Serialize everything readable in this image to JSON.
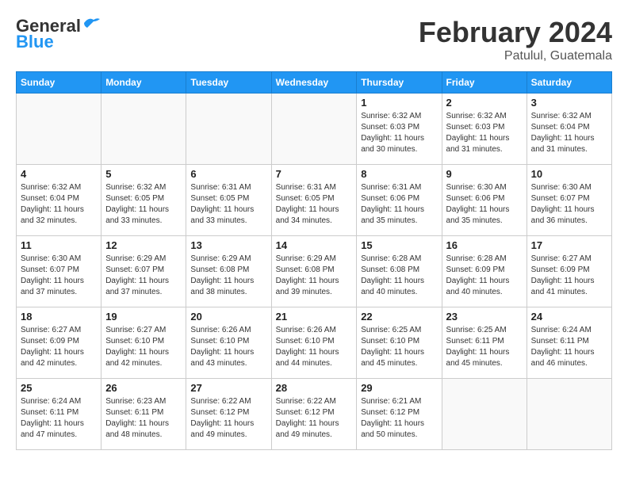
{
  "header": {
    "logo_general": "General",
    "logo_blue": "Blue",
    "month": "February 2024",
    "location": "Patulul, Guatemala"
  },
  "days_of_week": [
    "Sunday",
    "Monday",
    "Tuesday",
    "Wednesday",
    "Thursday",
    "Friday",
    "Saturday"
  ],
  "weeks": [
    [
      {
        "day": "",
        "empty": true
      },
      {
        "day": "",
        "empty": true
      },
      {
        "day": "",
        "empty": true
      },
      {
        "day": "",
        "empty": true
      },
      {
        "day": "1",
        "sunrise": "Sunrise: 6:32 AM",
        "sunset": "Sunset: 6:03 PM",
        "daylight": "Daylight: 11 hours and 30 minutes."
      },
      {
        "day": "2",
        "sunrise": "Sunrise: 6:32 AM",
        "sunset": "Sunset: 6:03 PM",
        "daylight": "Daylight: 11 hours and 31 minutes."
      },
      {
        "day": "3",
        "sunrise": "Sunrise: 6:32 AM",
        "sunset": "Sunset: 6:04 PM",
        "daylight": "Daylight: 11 hours and 31 minutes."
      }
    ],
    [
      {
        "day": "4",
        "sunrise": "Sunrise: 6:32 AM",
        "sunset": "Sunset: 6:04 PM",
        "daylight": "Daylight: 11 hours and 32 minutes."
      },
      {
        "day": "5",
        "sunrise": "Sunrise: 6:32 AM",
        "sunset": "Sunset: 6:05 PM",
        "daylight": "Daylight: 11 hours and 33 minutes."
      },
      {
        "day": "6",
        "sunrise": "Sunrise: 6:31 AM",
        "sunset": "Sunset: 6:05 PM",
        "daylight": "Daylight: 11 hours and 33 minutes."
      },
      {
        "day": "7",
        "sunrise": "Sunrise: 6:31 AM",
        "sunset": "Sunset: 6:05 PM",
        "daylight": "Daylight: 11 hours and 34 minutes."
      },
      {
        "day": "8",
        "sunrise": "Sunrise: 6:31 AM",
        "sunset": "Sunset: 6:06 PM",
        "daylight": "Daylight: 11 hours and 35 minutes."
      },
      {
        "day": "9",
        "sunrise": "Sunrise: 6:30 AM",
        "sunset": "Sunset: 6:06 PM",
        "daylight": "Daylight: 11 hours and 35 minutes."
      },
      {
        "day": "10",
        "sunrise": "Sunrise: 6:30 AM",
        "sunset": "Sunset: 6:07 PM",
        "daylight": "Daylight: 11 hours and 36 minutes."
      }
    ],
    [
      {
        "day": "11",
        "sunrise": "Sunrise: 6:30 AM",
        "sunset": "Sunset: 6:07 PM",
        "daylight": "Daylight: 11 hours and 37 minutes."
      },
      {
        "day": "12",
        "sunrise": "Sunrise: 6:29 AM",
        "sunset": "Sunset: 6:07 PM",
        "daylight": "Daylight: 11 hours and 37 minutes."
      },
      {
        "day": "13",
        "sunrise": "Sunrise: 6:29 AM",
        "sunset": "Sunset: 6:08 PM",
        "daylight": "Daylight: 11 hours and 38 minutes."
      },
      {
        "day": "14",
        "sunrise": "Sunrise: 6:29 AM",
        "sunset": "Sunset: 6:08 PM",
        "daylight": "Daylight: 11 hours and 39 minutes."
      },
      {
        "day": "15",
        "sunrise": "Sunrise: 6:28 AM",
        "sunset": "Sunset: 6:08 PM",
        "daylight": "Daylight: 11 hours and 40 minutes."
      },
      {
        "day": "16",
        "sunrise": "Sunrise: 6:28 AM",
        "sunset": "Sunset: 6:09 PM",
        "daylight": "Daylight: 11 hours and 40 minutes."
      },
      {
        "day": "17",
        "sunrise": "Sunrise: 6:27 AM",
        "sunset": "Sunset: 6:09 PM",
        "daylight": "Daylight: 11 hours and 41 minutes."
      }
    ],
    [
      {
        "day": "18",
        "sunrise": "Sunrise: 6:27 AM",
        "sunset": "Sunset: 6:09 PM",
        "daylight": "Daylight: 11 hours and 42 minutes."
      },
      {
        "day": "19",
        "sunrise": "Sunrise: 6:27 AM",
        "sunset": "Sunset: 6:10 PM",
        "daylight": "Daylight: 11 hours and 42 minutes."
      },
      {
        "day": "20",
        "sunrise": "Sunrise: 6:26 AM",
        "sunset": "Sunset: 6:10 PM",
        "daylight": "Daylight: 11 hours and 43 minutes."
      },
      {
        "day": "21",
        "sunrise": "Sunrise: 6:26 AM",
        "sunset": "Sunset: 6:10 PM",
        "daylight": "Daylight: 11 hours and 44 minutes."
      },
      {
        "day": "22",
        "sunrise": "Sunrise: 6:25 AM",
        "sunset": "Sunset: 6:10 PM",
        "daylight": "Daylight: 11 hours and 45 minutes."
      },
      {
        "day": "23",
        "sunrise": "Sunrise: 6:25 AM",
        "sunset": "Sunset: 6:11 PM",
        "daylight": "Daylight: 11 hours and 45 minutes."
      },
      {
        "day": "24",
        "sunrise": "Sunrise: 6:24 AM",
        "sunset": "Sunset: 6:11 PM",
        "daylight": "Daylight: 11 hours and 46 minutes."
      }
    ],
    [
      {
        "day": "25",
        "sunrise": "Sunrise: 6:24 AM",
        "sunset": "Sunset: 6:11 PM",
        "daylight": "Daylight: 11 hours and 47 minutes."
      },
      {
        "day": "26",
        "sunrise": "Sunrise: 6:23 AM",
        "sunset": "Sunset: 6:11 PM",
        "daylight": "Daylight: 11 hours and 48 minutes."
      },
      {
        "day": "27",
        "sunrise": "Sunrise: 6:22 AM",
        "sunset": "Sunset: 6:12 PM",
        "daylight": "Daylight: 11 hours and 49 minutes."
      },
      {
        "day": "28",
        "sunrise": "Sunrise: 6:22 AM",
        "sunset": "Sunset: 6:12 PM",
        "daylight": "Daylight: 11 hours and 49 minutes."
      },
      {
        "day": "29",
        "sunrise": "Sunrise: 6:21 AM",
        "sunset": "Sunset: 6:12 PM",
        "daylight": "Daylight: 11 hours and 50 minutes."
      },
      {
        "day": "",
        "empty": true
      },
      {
        "day": "",
        "empty": true
      }
    ]
  ]
}
